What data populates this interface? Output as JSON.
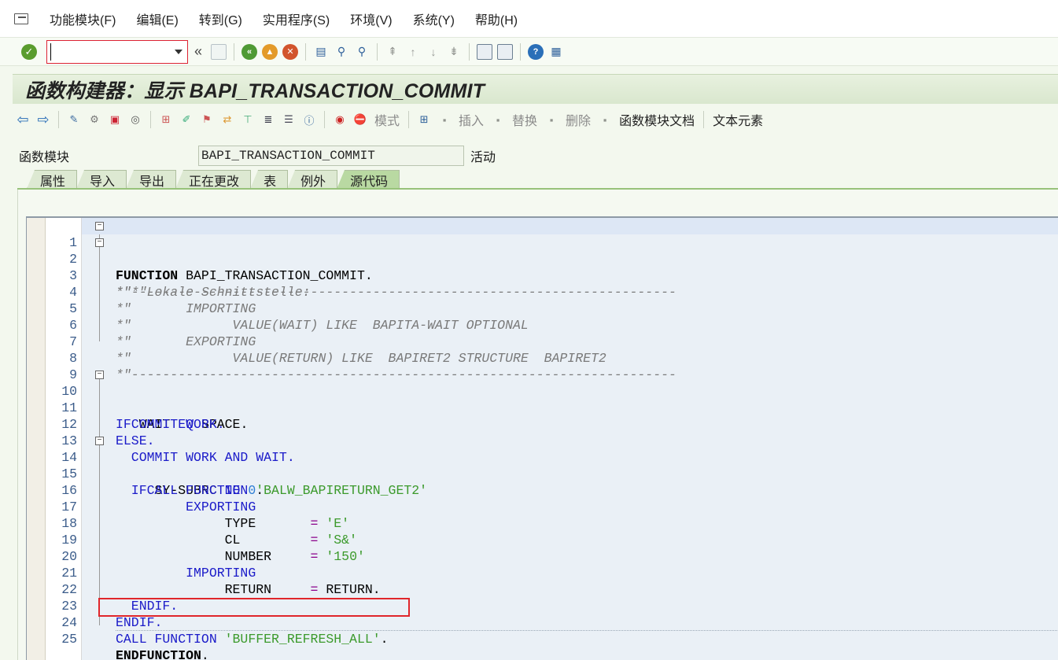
{
  "menubar": {
    "items": [
      "功能模块(F)",
      "编辑(E)",
      "转到(G)",
      "实用程序(S)",
      "环境(V)",
      "系统(Y)",
      "帮助(H)"
    ]
  },
  "stdbar": {
    "command_value": "",
    "icons": [
      "enter-icon",
      "save-icon",
      "back-icon",
      "exit-icon",
      "cancel-icon",
      "print-icon",
      "find-icon",
      "find-next-icon",
      "first-page-icon",
      "prev-page-icon",
      "next-page-icon",
      "last-page-icon",
      "new-session-icon",
      "shortcut-icon",
      "help-icon",
      "layout-icon"
    ]
  },
  "title": "函数构建器：显示 BAPI_TRANSACTION_COMMIT",
  "appbar": {
    "pattern_label": "模式",
    "insert_label": "插入",
    "replace_label": "替换",
    "delete_label": "删除",
    "fm_doc_label": "函数模块文档",
    "text_elements_label": "文本元素"
  },
  "function_module": {
    "label": "函数模块",
    "value": "BAPI_TRANSACTION_COMMIT",
    "status": "活动"
  },
  "tabs": [
    "属性",
    "导入",
    "导出",
    "正在更改",
    "表",
    "例外",
    "源代码"
  ],
  "active_tab": "源代码",
  "colors": {
    "keyword": "#1b1bc9",
    "string": "#3c9a2c",
    "comment": "#7a7a7a",
    "highlight_box": "#e0262b"
  },
  "code": {
    "line_numbers": [
      "1",
      "2",
      "3",
      "4",
      "5",
      "6",
      "7",
      "8",
      "9",
      "10",
      "11",
      "12",
      "13",
      "14",
      "15",
      "16",
      "17",
      "18",
      "19",
      "20",
      "21",
      "22",
      "23",
      "24",
      "25"
    ],
    "l1a": "FUNCTION",
    "l1b": " BAPI_TRANSACTION_COMMIT.",
    "l2": "*\"----------------------------------------------------------------------",
    "l3": "*\"*\"Lokale Schnittstelle:",
    "l4": "*\"       IMPORTING",
    "l5": "*\"             VALUE(WAIT) LIKE  BAPITA-WAIT OPTIONAL",
    "l6": "*\"       EXPORTING",
    "l7": "*\"             VALUE(RETURN) LIKE  BAPIRET2 STRUCTURE  BAPIRET2",
    "l8": "*\"----------------------------------------------------------------------",
    "l10a": "IF",
    "l10b": " WAIT ",
    "l10c": "EQ",
    "l10d": " SPACE.",
    "l11": "  COMMIT WORK.",
    "l12": "ELSE.",
    "l13": "  COMMIT WORK AND WAIT.",
    "l14a": "  IF",
    "l14b": " SY-SUBRC ",
    "l14c": "NE",
    "l14d": " ",
    "l14e": "0",
    "l14f": ".",
    "l15a": "    CALL FUNCTION ",
    "l15b": "'BALW_BAPIRETURN_GET2'",
    "l16": "         EXPORTING",
    "l17a": "              TYPE       ",
    "l17b": "=",
    "l17c": " ",
    "l17d": "'E'",
    "l18a": "              CL         ",
    "l18b": "=",
    "l18c": " ",
    "l18d": "'S&'",
    "l19a": "              NUMBER     ",
    "l19b": "=",
    "l19c": " ",
    "l19d": "'150'",
    "l20": "         IMPORTING",
    "l21a": "              RETURN     ",
    "l21b": "=",
    "l21c": " RETURN.",
    "l22": "  ENDIF.",
    "l23": "ENDIF.",
    "l24a": "CALL FUNCTION ",
    "l24b": "'BUFFER_REFRESH_ALL'",
    "l24c": ".",
    "l25a": "ENDFUNCTION",
    "l25b": "."
  }
}
